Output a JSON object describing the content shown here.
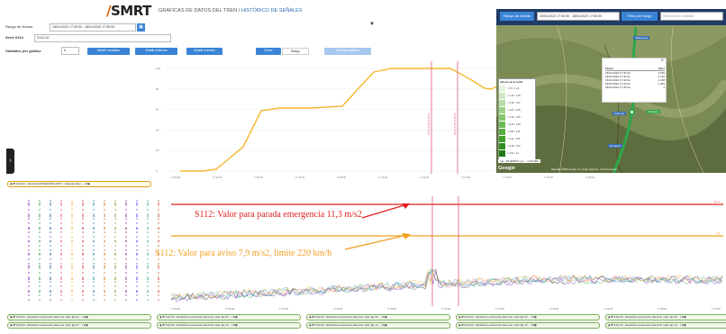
{
  "header": {
    "logo_prefix": "/",
    "logo_text": "SMRT",
    "title_main": "GRÁFICAS DE DATOS DEL TREN /",
    "title_sub": "HISTÓRICO DE SEÑALES",
    "filter_icon": "filter-icon"
  },
  "filters": {
    "date_range_label": "Rango de fechas",
    "date_range_value": "18/01/2020 17:30:00 - 18/01/2020 17:50:00",
    "series_label": "Serie S112",
    "series_value": "S112-00",
    "variables_label": "Variables por gráfico",
    "variables_value": "6"
  },
  "toolbar": {
    "add_variables": "Añadir variables",
    "add_metrics": "Añadir métricas",
    "add_events": "Añadir eventos",
    "zoom": "Zoom",
    "range": "Rango",
    "export": "Exportar gráficas"
  },
  "chart_top": {
    "y_ticks": [
      "100",
      "80",
      "60",
      "40",
      "20",
      "0"
    ],
    "x_ticks": [
      "17:30:00",
      "17:32:00",
      "17:34:00",
      "17:36:00",
      "17:38:00",
      "17:40:00",
      "17:42:00",
      "17:44:00",
      "17:46:00",
      "17:48:00",
      "17:50:00"
    ],
    "marker_labels": [
      "18:00:15 18:00:00:00",
      "18:00:15 18:00:00:00"
    ],
    "chip": "S112-00 - Velocidad (STREAMING MQTT - Gateway Mem..."
  },
  "chart_bottom": {
    "threshold_emergency_value": "11,3",
    "threshold_warning_value": "7,9",
    "annotation_emergency": "S112: Valor para parada emergencia 11,3 m/s2",
    "annotation_warning": "S112: Valor para aviso 7,9 m/s2, límite 220 km/h",
    "x_ticks": [
      "17:30:00",
      "17:32:00",
      "17:34:00",
      "17:36:00",
      "17:38:00",
      "17:40:00",
      "17:42:00",
      "17:44:00",
      "17:46:00",
      "17:48:00",
      "17:50:00"
    ]
  },
  "legend_chips_row1": [
    "S112-00 - Estadístico aceleración lateral de rodal. Eje 01...",
    "S112-00 - Estadístico aceleración lateral de rodal. Eje 02...",
    "S112-00 - Estadístico aceleración lateral de rodal. Eje 03...",
    "S112-00 - Estadístico aceleración lateral de rodal. Eje 04...",
    "S112-00 - Estadístico aceleración lateral de rodal. Eje 05..."
  ],
  "legend_chips_row2": [
    "S112-00 - Estadístico aceleración lateral de rodal. Eje 07...",
    "S112-00 - Estadístico aceleración lateral de rodal. Eje 10...",
    "S112-00 - Estadístico aceleración lateral de rodal. Eje 12...",
    "S112-00 - Estadístico aceleración lateral de rodal. Eje 13...",
    "S112-00 - Estadístico aceleración lateral de rodal. Eje 14..."
  ],
  "map": {
    "range_label": "Rango de fechas",
    "range_value": "18/01/2020 17:30:00 - 18/01/2020 17:50:00",
    "filter_button": "Filtro por rango",
    "select_placeholder": "Seleccionar variables",
    "popup_headers": [
      "Fecha",
      "Valor"
    ],
    "popup_rows": [
      [
        "18/01/2020 17:40:00",
        "3.065"
      ],
      [
        "18/01/2020 17:40:01",
        "3.120"
      ],
      [
        "18/01/2020 17:40:02",
        "3.188"
      ],
      [
        "18/01/2020 17:40:03",
        "3.065"
      ],
      [
        "18/01/2020 17:40:04",
        "3"
      ]
    ],
    "signal_legend_title": "Valores de la señal",
    "signal_legend_items": [
      "< 0.0 - 1.13",
      "< 1.13 - 1.45",
      "< 1.45 - 1.97",
      "< 1.97 - 2.35",
      "< 2.35 - 2.65",
      "< 2.65 - 2.83",
      "< 2.83 - 3.11",
      "< 3.11 - 3.35",
      "< 3.35 - 3.61",
      "< 3.61 - 4.1"
    ],
    "coords": "Lat.: 38.008872 Lon.: -4.571980",
    "google_label": "Google",
    "footer": "Map data ©2020 Google, Inst. Geogr. Nacional · Términos de uso",
    "close_glyph": "×",
    "place_labels": [
      "Villanueva",
      "Adamuz",
      "Montoro",
      "El Carpio"
    ]
  },
  "colors": {
    "speed_line": "#f5b730",
    "marker": "#e05a7a",
    "emergency": "#e02020",
    "warning": "#f0a020",
    "accent": "#3a84d6"
  }
}
